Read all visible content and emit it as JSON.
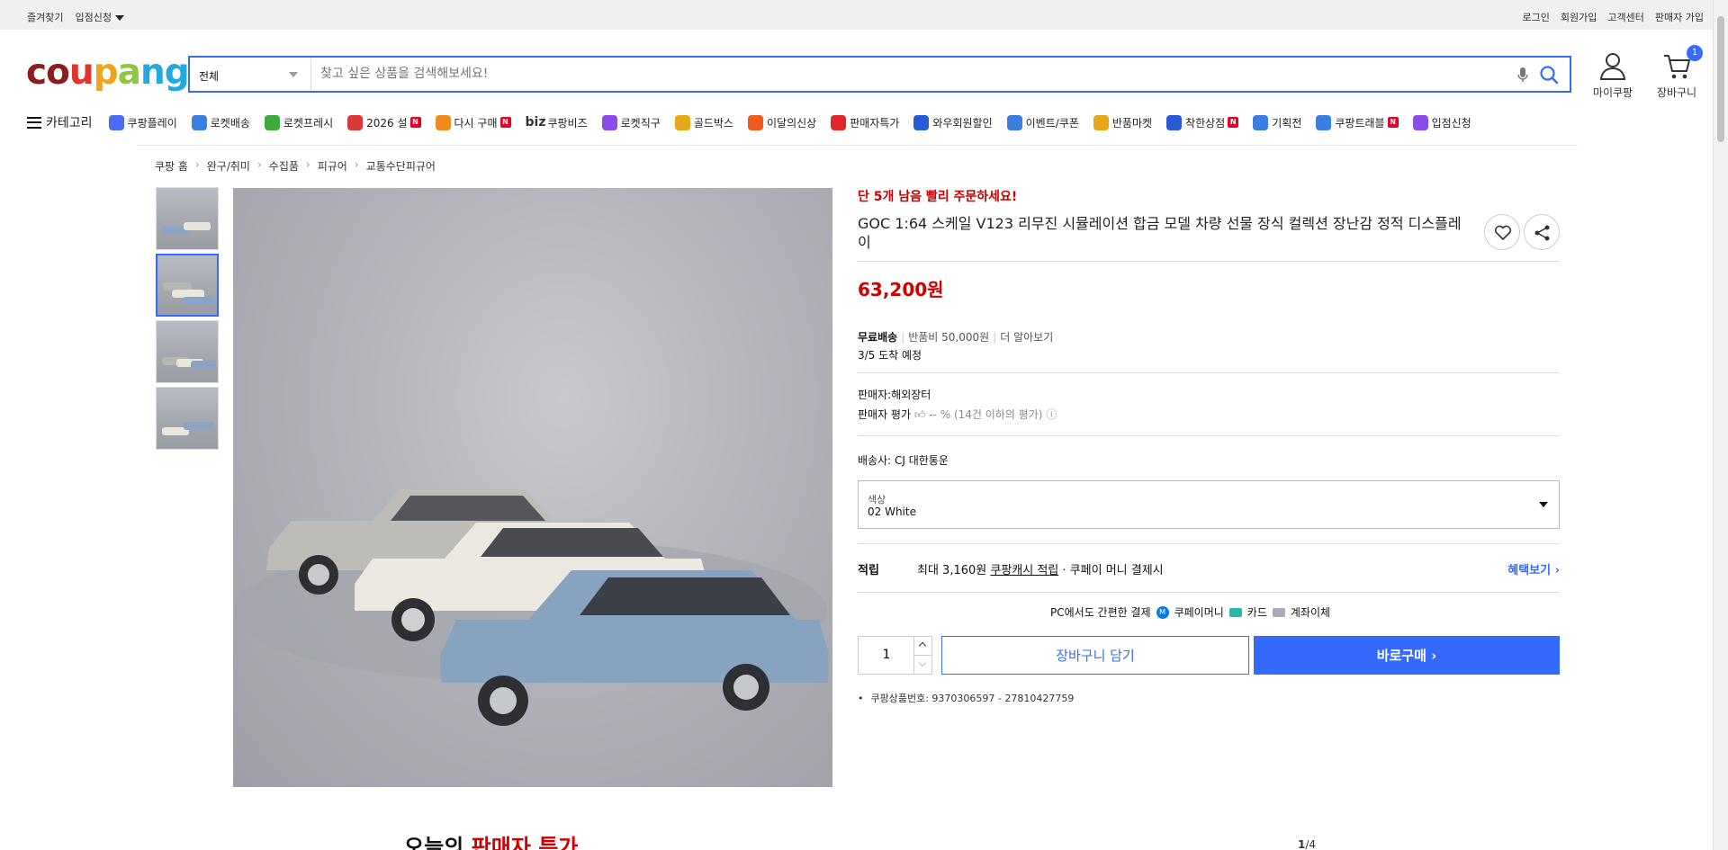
{
  "topbar": {
    "left": [
      "즐겨찾기",
      "입점신청"
    ],
    "right": [
      "로그인",
      "회원가입",
      "고객센터",
      "판매자 가입"
    ]
  },
  "header": {
    "logo": "coupang",
    "logo_letters": [
      {
        "ch": "c",
        "color": "#8b1d1f"
      },
      {
        "ch": "o",
        "color": "#8b1d1f"
      },
      {
        "ch": "u",
        "color": "#e0342c"
      },
      {
        "ch": "p",
        "color": "#f0a518"
      },
      {
        "ch": "a",
        "color": "#8ec63f"
      },
      {
        "ch": "n",
        "color": "#23a8e0"
      },
      {
        "ch": "g",
        "color": "#23a8e0"
      }
    ],
    "search_category": "전체",
    "search_placeholder": "찾고 싶은 상품을 검색해보세요!",
    "mypage_label": "마이쿠팡",
    "cart_label": "장바구니",
    "cart_count": "1"
  },
  "nav": {
    "menu_label": "카테고리",
    "items": [
      {
        "label": "쿠팡플레이",
        "icon": "play-icon",
        "color": "#4a6cf7",
        "badge": false
      },
      {
        "label": "로켓배송",
        "icon": "rocket-icon",
        "color": "#3a80e0",
        "badge": false
      },
      {
        "label": "로켓프레시",
        "icon": "rocket-fresh-icon",
        "color": "#3caa3c",
        "badge": false
      },
      {
        "label": "2026 설",
        "icon": "gift-icon",
        "color": "#d83a3a",
        "badge": true
      },
      {
        "label": "다시 구매",
        "icon": "basket-icon",
        "color": "#f08a1c",
        "badge": true
      },
      {
        "label": "쿠팡비즈",
        "prefix": "biz",
        "icon": "biz-icon",
        "color": "#ffffff",
        "badge": false
      },
      {
        "label": "로켓직구",
        "icon": "direct-icon",
        "color": "#8a4be8",
        "badge": false
      },
      {
        "label": "골드박스",
        "icon": "goldbox-icon",
        "color": "#e6a817",
        "badge": false
      },
      {
        "label": "이달의신상",
        "icon": "new-icon",
        "color": "#f05a1c",
        "badge": false
      },
      {
        "label": "판매자특가",
        "icon": "percent-icon",
        "color": "#e02828",
        "badge": false
      },
      {
        "label": "와우회원할인",
        "icon": "wow-icon",
        "color": "#2a5bd7",
        "badge": false
      },
      {
        "label": "이벤트/쿠폰",
        "icon": "coupon-icon",
        "color": "#3a7ee0",
        "badge": false
      },
      {
        "label": "반품마켓",
        "icon": "return-market-icon",
        "color": "#e6a817",
        "badge": false
      },
      {
        "label": "착한상점",
        "icon": "store-icon",
        "color": "#2a5bd7",
        "badge": true
      },
      {
        "label": "기획전",
        "icon": "tag-icon",
        "color": "#3a7ee0",
        "badge": false
      },
      {
        "label": "쿠팡트래블",
        "icon": "travel-icon",
        "color": "#3a7ee0",
        "badge": true
      },
      {
        "label": "입점신청",
        "icon": "apply-icon",
        "color": "#8a4be8",
        "badge": false
      }
    ]
  },
  "breadcrumb": [
    "쿠팡 홈",
    "완구/취미",
    "수집품",
    "피규어",
    "교통수단피규어"
  ],
  "product": {
    "urgent": "단 5개 남음 빨리 주문하세요!",
    "title": "GOC 1:64 스케일 V123 리무진 시뮬레이션 합금 모델 차량 선물 장식 컬렉션 장난감 정적 디스플레이",
    "price": "63,200원",
    "shipping_free": "무료배송",
    "shipping_return": "반품비 50,000원",
    "shipping_more": "더 알아보기",
    "arrival": "3/5 도착 예정",
    "seller": "판매자:해외장터",
    "rating_label": "판매자 평가",
    "rating_value": "-- %",
    "rating_note": "(14건 이하의 평가)",
    "courier": "배송사:  CJ 대한통운",
    "option_label": "색상",
    "option_value": "02 White",
    "earn_label": "적립",
    "earn_text_1": "최대 3,160원",
    "earn_text_2": "쿠팡캐시 적립",
    "earn_text_3": "· 쿠페이 머니 결제시",
    "earn_benefit": "혜택보기",
    "pay_title": "PC에서도 간편한 결제",
    "pay_methods": [
      "쿠페이머니",
      "카드",
      "계좌이체"
    ],
    "qty": "1",
    "cart_button": "장바구니 담기",
    "buy_button": "바로구매",
    "product_id": "쿠팡상품번호: 9370306597 - 27810427759"
  },
  "deal": {
    "title_1": "오늘의",
    "title_2": "판매자 특가"
  },
  "pager": {
    "current": "1",
    "total": "/4"
  },
  "colors": {
    "accent": "#346aff",
    "price": "#cc0000"
  }
}
